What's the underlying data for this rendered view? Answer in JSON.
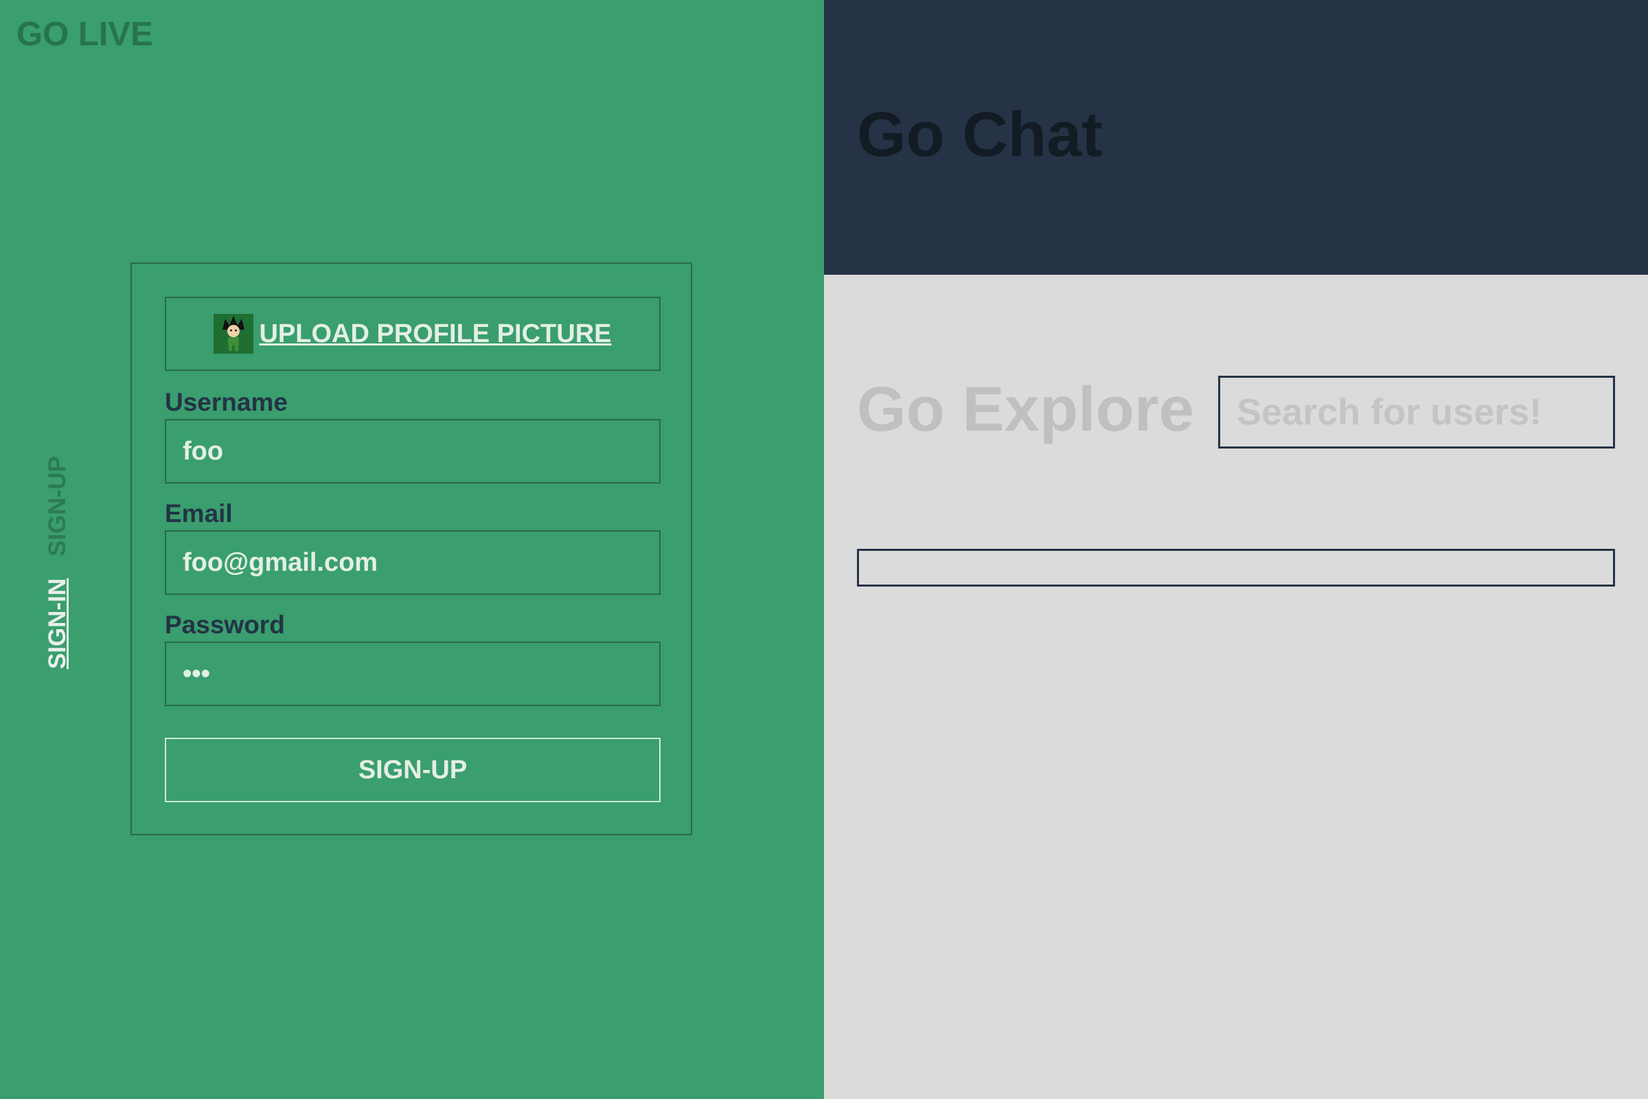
{
  "brand": {
    "title": "GO LIVE"
  },
  "auth_tabs": [
    {
      "label": "SIGN-IN",
      "active": false
    },
    {
      "label": "SIGN-UP",
      "active": true
    }
  ],
  "form": {
    "upload_label": "UPLOAD PROFILE PICTURE",
    "avatar_icon": "avatar-icon",
    "fields": {
      "username": {
        "label": "Username",
        "value": "foo"
      },
      "email": {
        "label": "Email",
        "value": "foo@gmail.com"
      },
      "password": {
        "label": "Password",
        "value": "foo"
      }
    },
    "submit_label": "SIGN-UP"
  },
  "chat": {
    "title": "Go Chat"
  },
  "explore": {
    "title": "Go Explore",
    "search_placeholder": "Search for users!",
    "search_value": ""
  },
  "colors": {
    "left_bg": "#3a9e6f",
    "header_bg": "#263346",
    "explore_bg": "#dbdbdb",
    "text_light": "#e4efe3",
    "label_dark": "#233445"
  }
}
